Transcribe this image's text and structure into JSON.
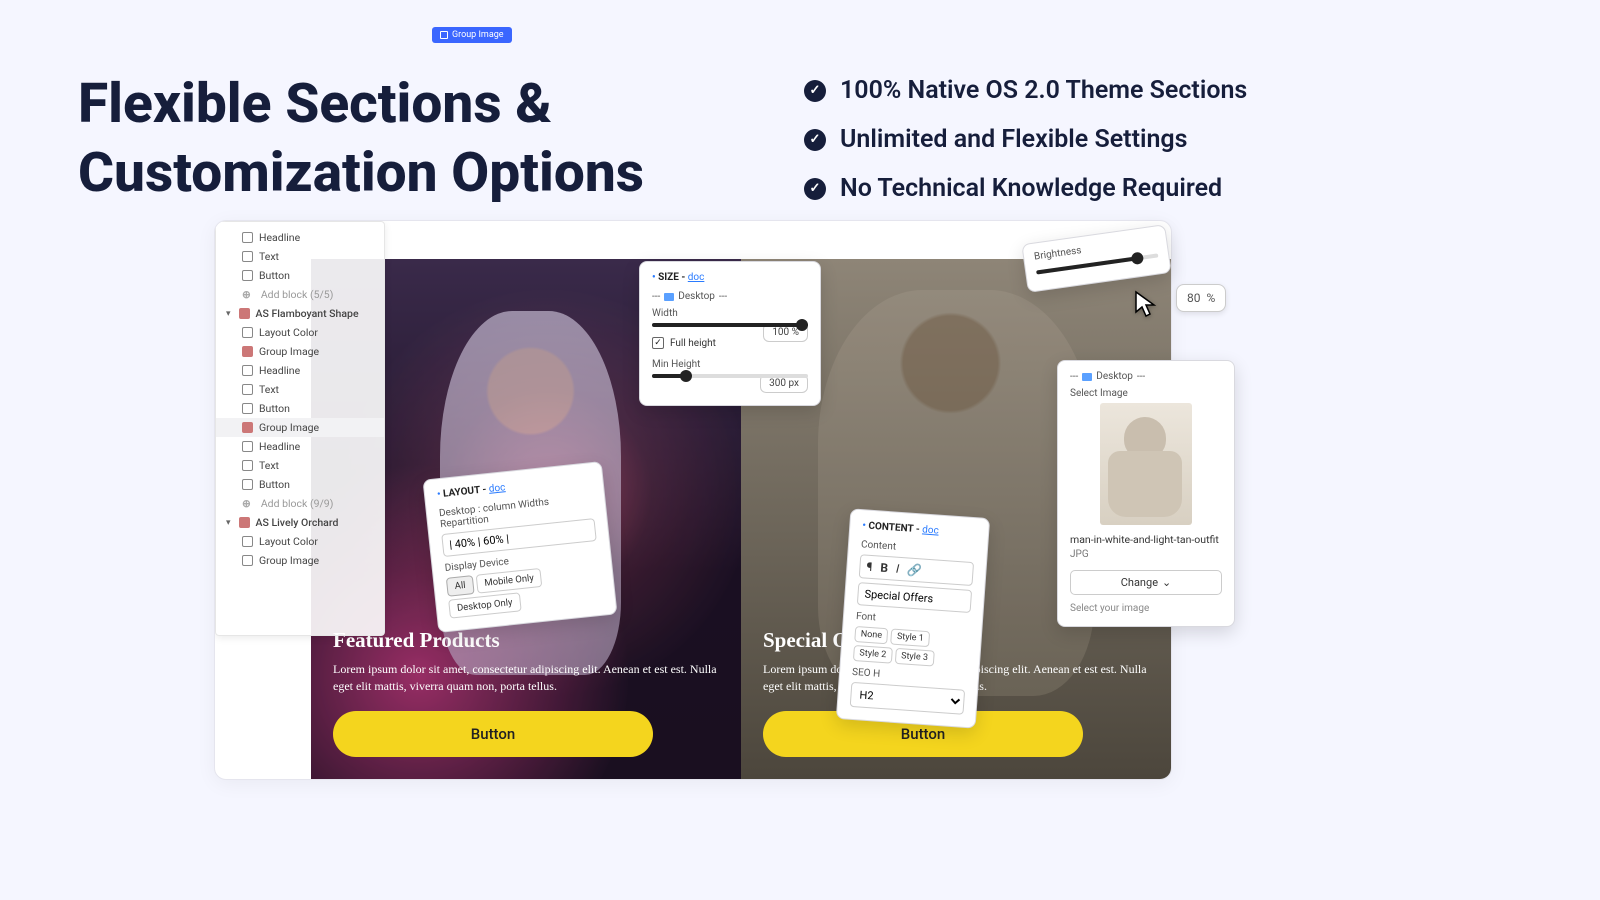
{
  "hero": {
    "title_line1": "Flexible Sections &",
    "title_line2": "Customization Options"
  },
  "features": [
    "100% Native OS 2.0 Theme Sections",
    "Unlimited and Flexible Settings",
    "No Technical Knowledge Required"
  ],
  "badge": {
    "label": "Group Image"
  },
  "tree": {
    "block1": {
      "headline": "Headline",
      "text": "Text",
      "button": "Button",
      "add": "Add block (5/5)"
    },
    "section1": {
      "name": "AS Flamboyant Shape",
      "items": [
        "Layout Color",
        "Group Image",
        "Headline",
        "Text",
        "Button",
        "Group Image",
        "Headline",
        "Text",
        "Button"
      ],
      "add": "Add block (9/9)"
    },
    "section2": {
      "name": "AS Lively Orchard",
      "items": [
        "Layout Color",
        "Group Image"
      ]
    }
  },
  "panels": {
    "left": {
      "title": "Featured Products",
      "body": "Lorem ipsum dolor sit amet, consectetur adipiscing elit. Aenean et est est. Nulla eget elit mattis, viverra quam non, porta tellus.",
      "button": "Button"
    },
    "right": {
      "title": "Special Offers",
      "body": "Lorem ipsum dolor sit amet, consectetur adipiscing elit. Aenean et est est. Nulla eget elit mattis, viverra quam non, porta tellus.",
      "button": "Button"
    }
  },
  "size_panel": {
    "header": "SIZE - ",
    "doc": "doc",
    "desktop_label": "Desktop",
    "width_label": "Width",
    "width_value": "100",
    "width_unit": "%",
    "full_height": "Full height",
    "min_height_label": "Min Height",
    "min_height_value": "300",
    "min_height_unit": "px"
  },
  "layout_panel": {
    "header": "LAYOUT - ",
    "doc": "doc",
    "repartition_label": "Desktop : column Widths Repartition",
    "repartition_value": "| 40% | 60% |",
    "display_device_label": "Display Device",
    "device_options": [
      "All",
      "Mobile Only",
      "Desktop Only"
    ]
  },
  "content_panel": {
    "header": "CONTENT - ",
    "doc": "doc",
    "content_label": "Content",
    "content_value": "Special Offers",
    "font_label": "Font",
    "font_options": [
      "None",
      "Style 1",
      "Style 2",
      "Style 3"
    ],
    "seo_label": "SEO H",
    "seo_value": "H2"
  },
  "brightness_panel": {
    "label": "Brightness",
    "value": "80",
    "unit": "%"
  },
  "image_panel": {
    "desktop_label": "Desktop",
    "select_label": "Select Image",
    "filename": "man-in-white-and-light-tan-outfit",
    "filetype": "JPG",
    "change": "Change",
    "hint": "Select your image"
  }
}
